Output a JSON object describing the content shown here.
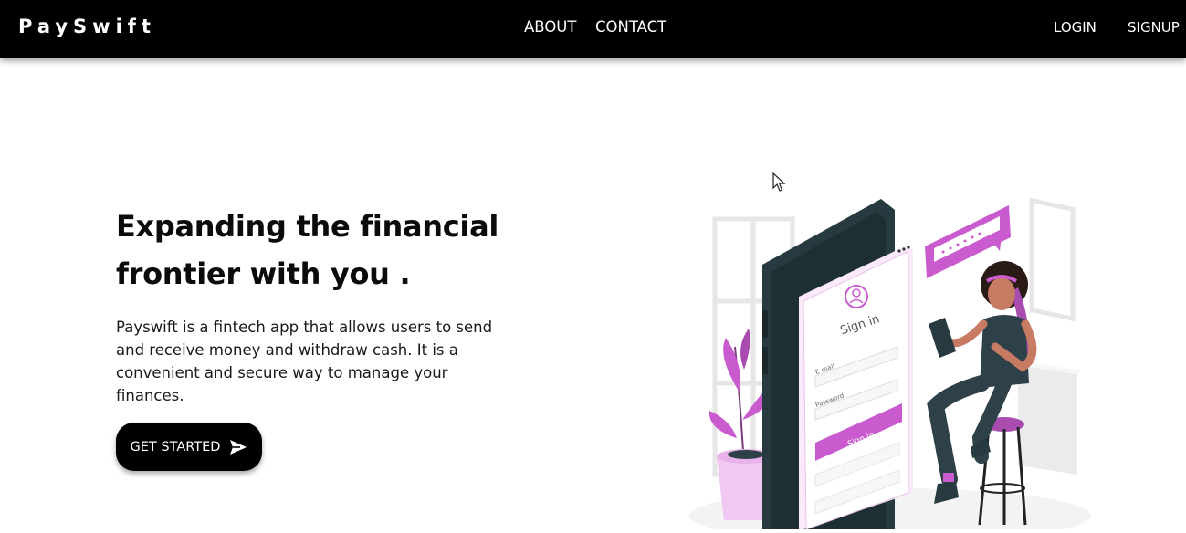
{
  "navbar": {
    "brand": "PaySwift",
    "links": [
      "ABOUT",
      "CONTACT"
    ],
    "auth": {
      "login": "LOGIN",
      "signup": "SIGNUP"
    }
  },
  "hero": {
    "title_line1": "Expanding the financial",
    "title_line2": "frontier with you .",
    "description": "Payswift is a fintech app that allows users to send and receive money and withdraw cash. It is a convenient and secure way to manage your finances.",
    "cta_label": "GET STARTED",
    "cta_icon": "send-arrow-icon"
  },
  "illustration": {
    "phone_heading": "Sign in",
    "email_label": "E-mail",
    "password_label": "Password",
    "signin_button": "Sign in",
    "accent_color": "#c95bcf",
    "phone_color": "#263a40"
  },
  "colors": {
    "navbar_bg": "#000000",
    "text": "#0b0b0b",
    "accent": "#c95bcf"
  }
}
